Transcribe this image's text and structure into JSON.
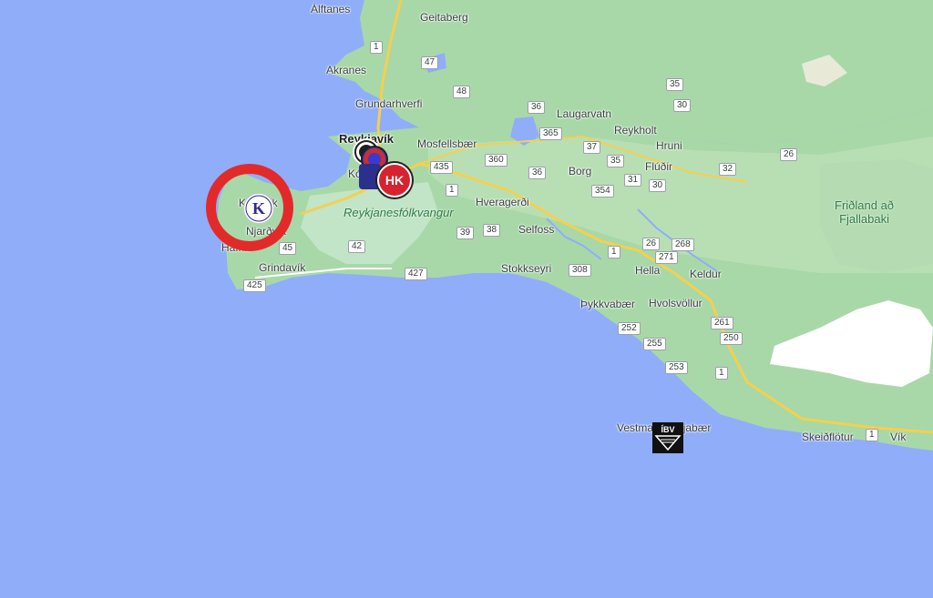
{
  "map": {
    "colors": {
      "water": "#90adfa",
      "land": "#a8d8a8",
      "land_light": "#cde6cd",
      "park": "#c1e5c6",
      "road": "#f4d04f",
      "highlight": "#e32a2a"
    },
    "places": [
      {
        "name": "Álftanes",
        "kind": "town"
      },
      {
        "name": "Geitaberg",
        "kind": "town"
      },
      {
        "name": "Akranes",
        "kind": "town"
      },
      {
        "name": "Grundarhverfi",
        "kind": "town"
      },
      {
        "name": "Reykjavík",
        "kind": "city"
      },
      {
        "name": "Mosfellsbær",
        "kind": "town"
      },
      {
        "name": "Laugarvatn",
        "kind": "town"
      },
      {
        "name": "Reykholt",
        "kind": "town"
      },
      {
        "name": "Hruni",
        "kind": "town"
      },
      {
        "name": "Flúðir",
        "kind": "town"
      },
      {
        "name": "Borg",
        "kind": "town"
      },
      {
        "name": "Hveragerði",
        "kind": "town"
      },
      {
        "name": "Selfoss",
        "kind": "town"
      },
      {
        "name": "Keflavík",
        "kind": "town"
      },
      {
        "name": "Njarðvík",
        "kind": "town"
      },
      {
        "name": "Grindavík",
        "kind": "town"
      },
      {
        "name": "Stokkseyri",
        "kind": "town"
      },
      {
        "name": "Hella",
        "kind": "town"
      },
      {
        "name": "Keldur",
        "kind": "town"
      },
      {
        "name": "Hvolsvöllur",
        "kind": "town"
      },
      {
        "name": "Þykkvabær",
        "kind": "town"
      },
      {
        "name": "Vestmannaeyjabær",
        "kind": "town"
      },
      {
        "name": "Skeiðflötur",
        "kind": "town"
      },
      {
        "name": "Vík",
        "kind": "town"
      },
      {
        "name": "Kópavogur",
        "kind": "town"
      },
      {
        "name": "Hafnir",
        "kind": "town"
      }
    ],
    "parks": [
      "Reykjanesfólkvangur",
      "Friðland að",
      "Fjallabaki"
    ],
    "roads": [
      "1",
      "47",
      "48",
      "36",
      "365",
      "37",
      "35",
      "30",
      "435",
      "360",
      "36",
      "354",
      "31",
      "30",
      "32",
      "26",
      "1",
      "39",
      "38",
      "427",
      "42",
      "425",
      "308",
      "1",
      "26",
      "268",
      "271",
      "252",
      "255",
      "253",
      "261",
      "250",
      "1",
      "1",
      "35",
      "45"
    ],
    "club_badges": [
      {
        "icon": "keflavik-k-crest-icon",
        "letter": "K"
      },
      {
        "icon": "hk-crest-icon",
        "letter": "HK"
      },
      {
        "icon": "ibv-crest-icon",
        "letter": "ÍBV"
      },
      {
        "icon": "club-crest-icon",
        "letter": ""
      },
      {
        "icon": "club-crest-icon",
        "letter": ""
      }
    ]
  }
}
